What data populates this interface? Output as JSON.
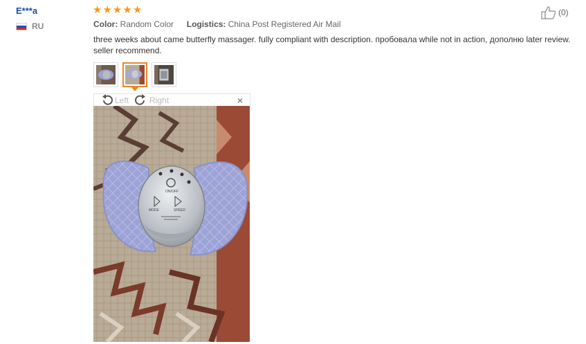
{
  "reviewer": {
    "name": "E***a",
    "country_code": "RU",
    "flag_colors": [
      "#ffffff",
      "#1d4fc4",
      "#d52b1e"
    ]
  },
  "rating": {
    "stars": 5,
    "max": 5,
    "color": "#f3991f"
  },
  "meta": {
    "color_label": "Color:",
    "color_value": "Random Color",
    "logistics_label": "Logistics:",
    "logistics_value": "China Post Registered Air Mail"
  },
  "helpful": {
    "icon": "thumbs-up-icon",
    "count": "(0)"
  },
  "review_text": "three weeks about came butterfly massager. fully compliant with description. пробовала while not in action, дополню later review. seller recommend.",
  "thumbnails": [
    {
      "name": "review-photo-1",
      "active": false
    },
    {
      "name": "review-photo-2",
      "active": true
    },
    {
      "name": "review-photo-3",
      "active": false
    }
  ],
  "viewer": {
    "rotate_left_label": "Left",
    "rotate_right_label": "Right",
    "close_icon": "×",
    "accent": "#e8862a",
    "photo_device_labels": {
      "top": "ON/OFF",
      "left": "MODE",
      "right": "SPEED"
    }
  }
}
